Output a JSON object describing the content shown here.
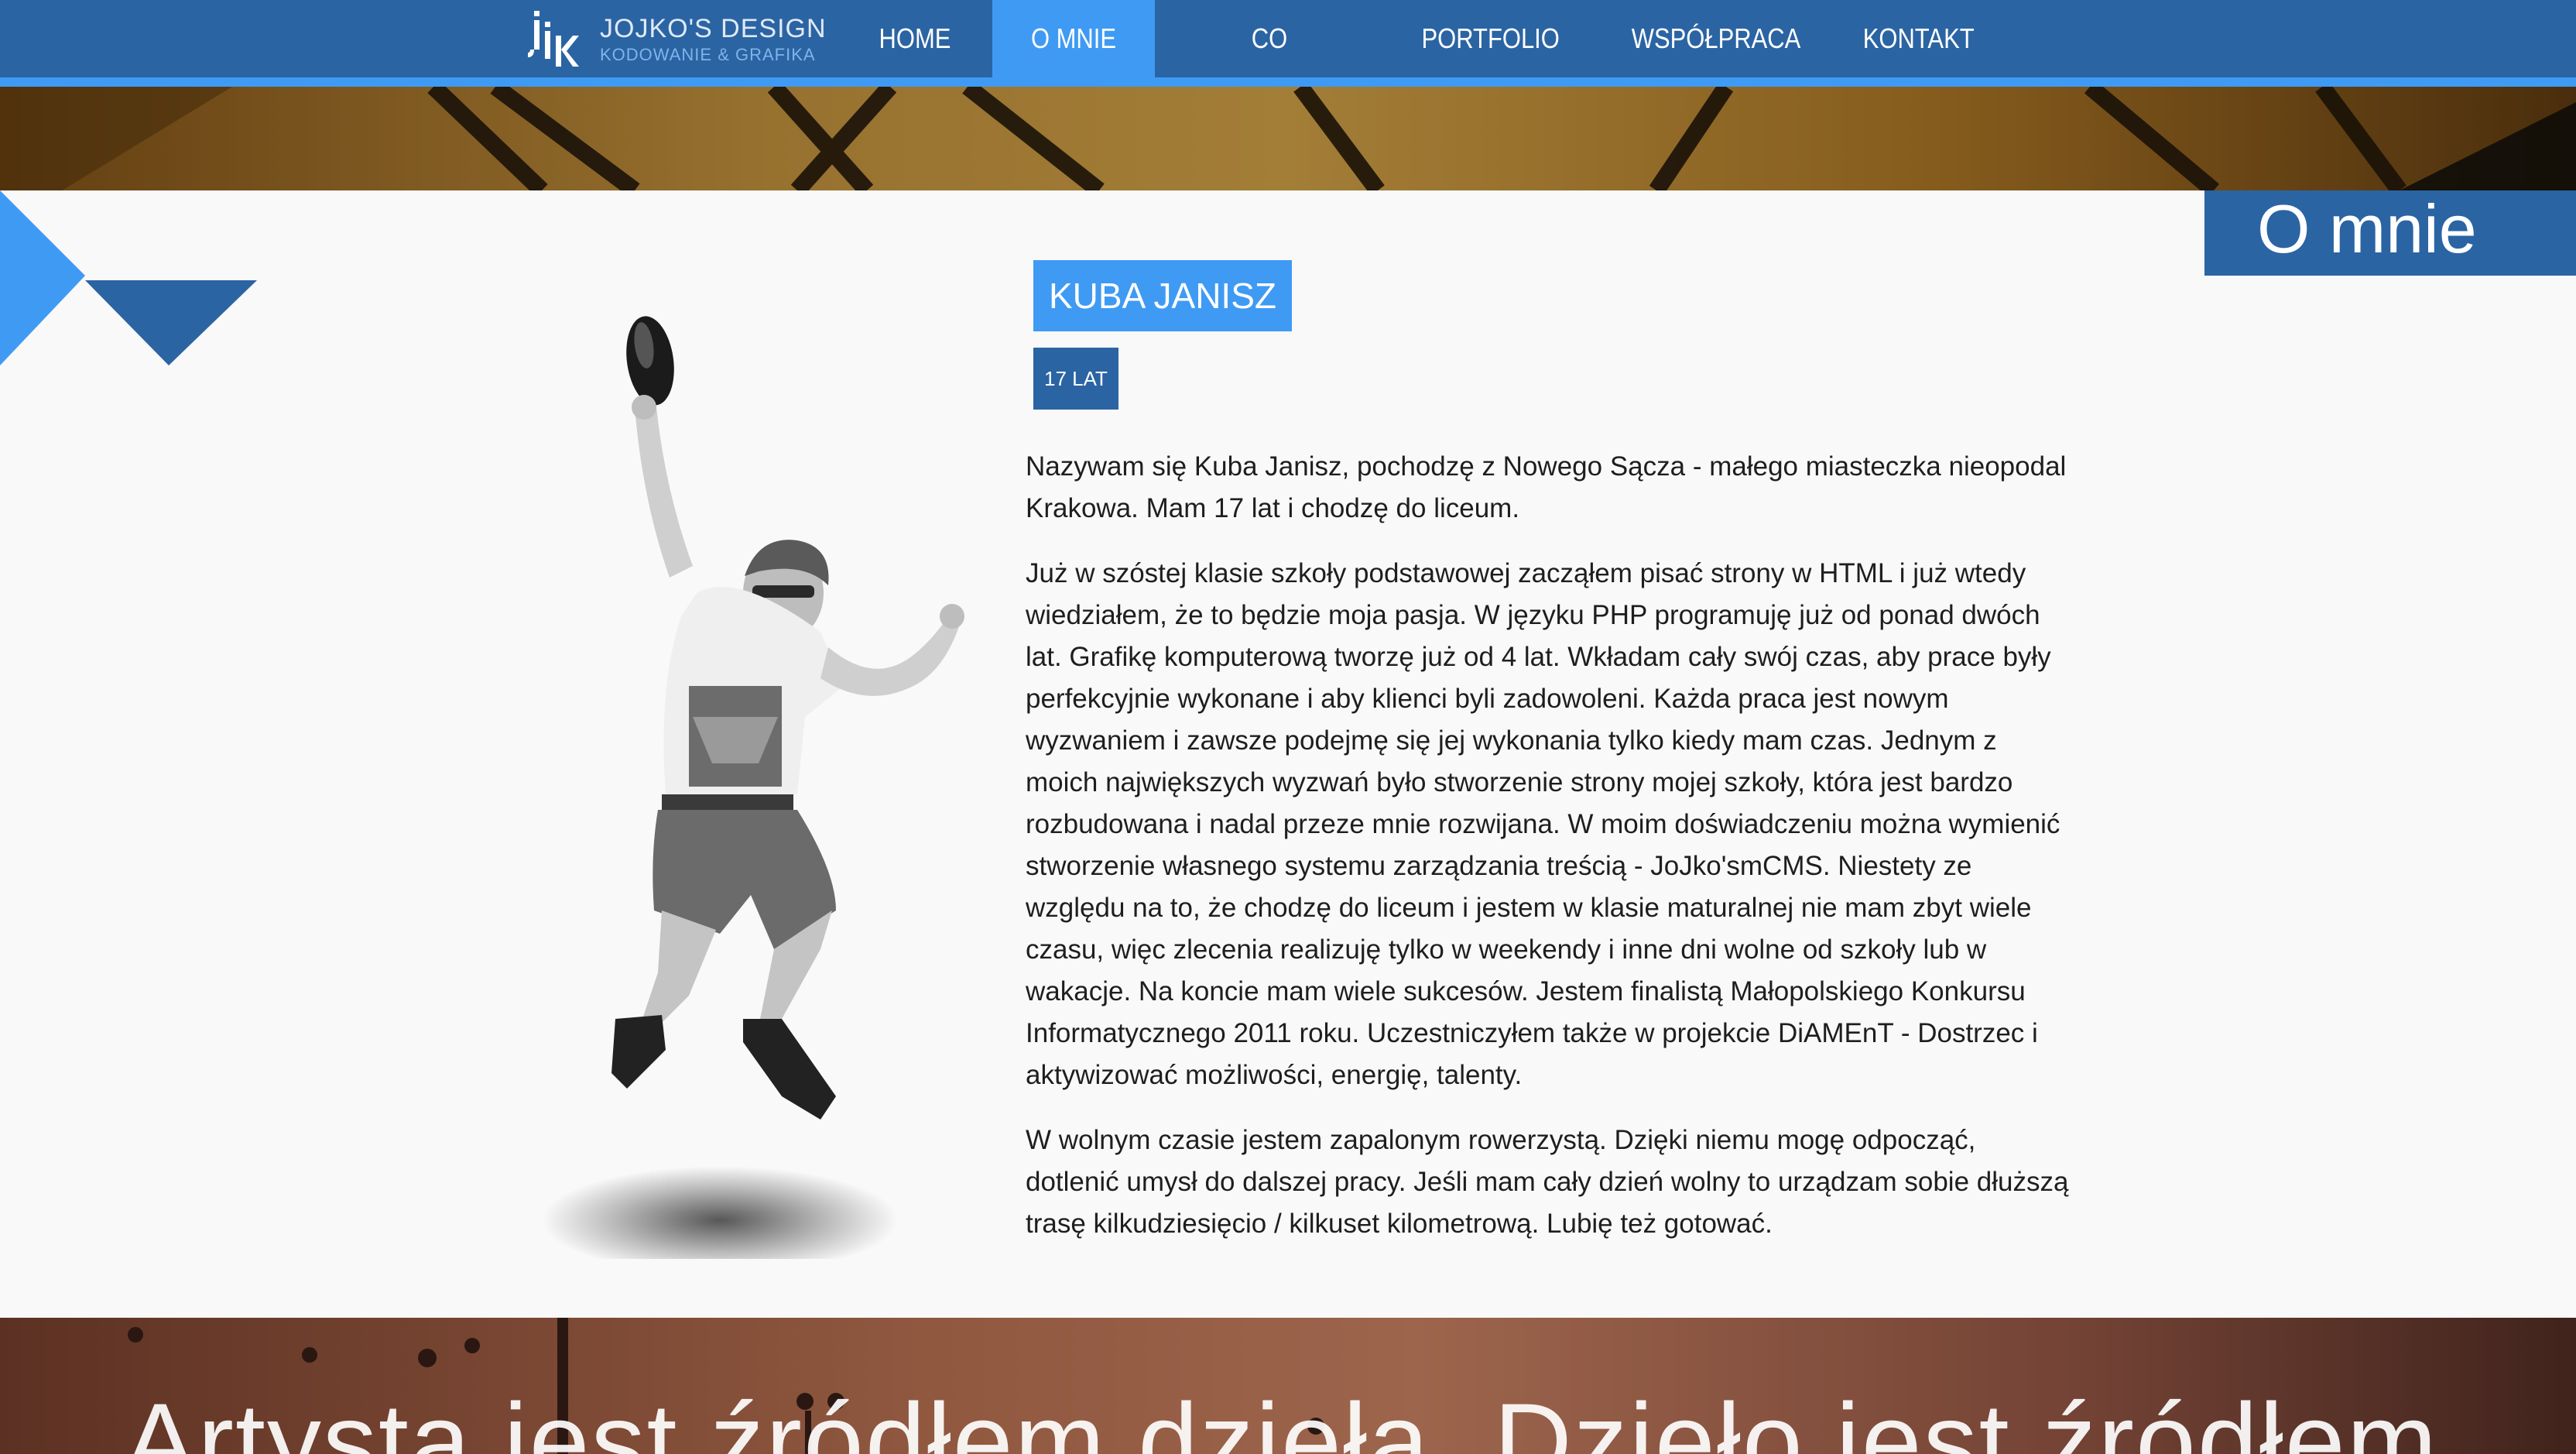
{
  "brand": {
    "title": "JOJKO'S DESIGN",
    "subtitle": "KODOWANIE & GRAFIKA",
    "mark": "JJK"
  },
  "nav": {
    "items": [
      {
        "label": "HOME",
        "active": false
      },
      {
        "label": "O MNIE",
        "active": true
      },
      {
        "label": "CO POTRAFIĘ?",
        "active": false
      },
      {
        "label": "PORTFOLIO",
        "active": false
      },
      {
        "label": "WSPÓŁPRACA",
        "active": false
      },
      {
        "label": "KONTAKT",
        "active": false
      }
    ]
  },
  "section": {
    "title": "O mnie"
  },
  "profile": {
    "name": "KUBA JANISZ",
    "age": "17 LAT",
    "paragraphs": [
      "Nazywam się Kuba Janisz, pochodzę z Nowego Sącza - małego miasteczka nieopodal Krakowa. Mam 17 lat i chodzę do liceum.",
      "Już w szóstej klasie szkoły podstawowej zacząłem pisać strony w HTML i już wtedy wiedziałem, że to będzie moja pasja. W języku PHP programuję już od ponad dwóch lat. Grafikę komputerową tworzę już od 4 lat. Wkładam cały swój czas, aby prace były perfekcyjnie wykonane i aby klienci byli zadowoleni. Każda praca jest nowym wyzwaniem i zawsze podejmę się jej wykonania tylko kiedy mam czas. Jednym z moich największych wyzwań było stworzenie strony mojej szkoły, która jest bardzo rozbudowana i nadal przeze mnie rozwijana. W moim doświadczeniu można wymienić stworzenie własnego systemu zarządzania treścią - JoJko'smCMS. Niestety ze względu na to, że chodzę do liceum i jestem w klasie maturalnej nie mam zbyt wiele czasu, więc zlecenia realizuję tylko w weekendy i inne dni wolne od szkoły lub w wakacje. Na koncie mam wiele sukcesów. Jestem finalistą Małopolskiego Konkursu Informatycznego 2011 roku. Uczestniczyłem także w projekcie DiAMEnT - Dostrzec i aktywizować możliwości, energię, talenty.",
      "W wolnym czasie jestem zapalonym rowerzystą. Dzięki niemu mogę odpocząć, dotlenić umysł do dalszej pracy. Jeśli mam cały dzień wolny to urządzam sobie dłuższą trasę kilkudziesięcio / kilkuset kilometrową. Lubię też gotować."
    ]
  },
  "quote": {
    "text": "Artysta jest źródłem dzieła. Dzieło jest źródłem"
  },
  "colors": {
    "nav_bg": "#2b64a3",
    "accent": "#3f9af4",
    "page_bg": "#f9f9f9"
  },
  "icons": {
    "logo": "jjk-logo-icon"
  }
}
